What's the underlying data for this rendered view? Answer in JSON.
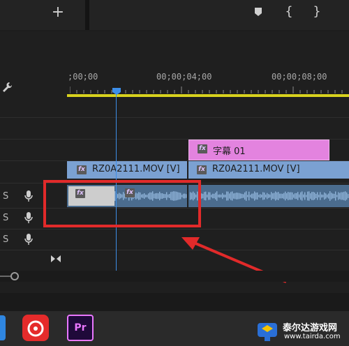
{
  "toolbar": {
    "add_label": "+",
    "in_point_label": "{",
    "out_point_label": "}"
  },
  "ruler": {
    "timecodes": [
      ";00;00",
      "00;00;04;00",
      "00;00;08;00"
    ]
  },
  "clips": {
    "caption": {
      "label": "字幕 01",
      "fx": "fx"
    },
    "video1": {
      "label": "RZ0A2111.MOV [V]",
      "fx": "fx"
    },
    "video2": {
      "label": "RZ0A2111.MOV [V]",
      "fx": "fx"
    },
    "audio1_fx": "fx",
    "audio2_fx": "fx"
  },
  "tracks": {
    "audio_labels": [
      "S",
      "S",
      "S"
    ]
  },
  "taskbar": {
    "premiere_label": "Pr"
  },
  "watermark": {
    "line1": "泰尔达游戏网",
    "line2": "www.tairda.com"
  },
  "colors": {
    "caption_clip": "#e383df",
    "video_clip": "#7ba1d2",
    "audio_clip": "#4b6c8e",
    "playhead": "#3d8ee8",
    "work_area_bar": "#d8d21e",
    "annotation": "#e12a2a"
  }
}
